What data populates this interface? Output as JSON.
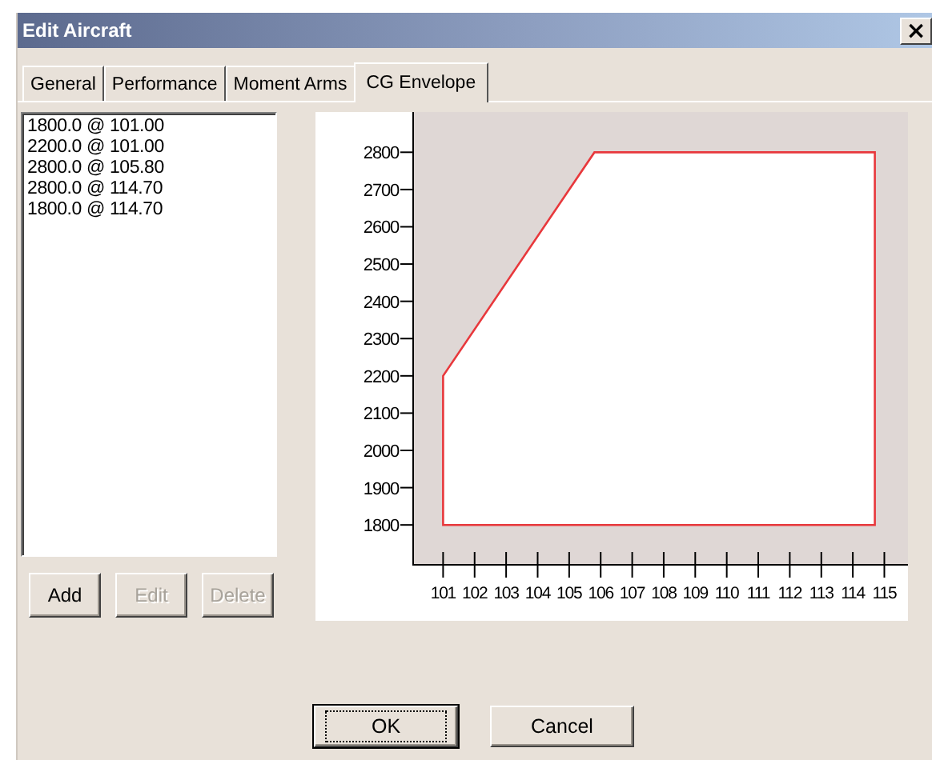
{
  "window": {
    "title": "Edit Aircraft",
    "close": "×"
  },
  "tabs": [
    {
      "label": "General",
      "selected": false
    },
    {
      "label": "Performance",
      "selected": false
    },
    {
      "label": "Moment Arms",
      "selected": false
    },
    {
      "label": "CG Envelope",
      "selected": true
    }
  ],
  "points": [
    "1800.0 @ 101.00",
    "2200.0 @ 101.00",
    "2800.0 @ 105.80",
    "2800.0 @ 114.70",
    "1800.0 @ 114.70"
  ],
  "list_buttons": [
    {
      "label": "Add",
      "disabled": false
    },
    {
      "label": "Edit",
      "disabled": true
    },
    {
      "label": "Delete",
      "disabled": true
    }
  ],
  "chart_data": {
    "type": "area",
    "x": [
      101,
      101,
      105.8,
      114.7,
      114.7,
      101
    ],
    "series": [
      {
        "color": "#e8383c",
        "values": [
          1800,
          2200,
          2800,
          2800,
          1800,
          1800
        ]
      }
    ],
    "xlim": [
      100.05,
      115.75
    ],
    "ylim": [
      1693,
      2908
    ],
    "xticks": [
      {
        "value": 101,
        "label": "101"
      },
      {
        "value": 102,
        "label": "102"
      },
      {
        "value": 103,
        "label": "103"
      },
      {
        "value": 104,
        "label": "104"
      },
      {
        "value": 105,
        "label": "105"
      },
      {
        "value": 106,
        "label": "106"
      },
      {
        "value": 107,
        "label": "107"
      },
      {
        "value": 108,
        "label": "108"
      },
      {
        "value": 109,
        "label": "109"
      },
      {
        "value": 110,
        "label": "110"
      },
      {
        "value": 111,
        "label": "111"
      },
      {
        "value": 112,
        "label": "112"
      },
      {
        "value": 113,
        "label": "113"
      },
      {
        "value": 114,
        "label": "114"
      },
      {
        "value": 115,
        "label": "115"
      }
    ],
    "yticks": [
      1800,
      1900,
      2000,
      2100,
      2200,
      2300,
      2400,
      2500,
      2600,
      2700,
      2800
    ]
  },
  "dialog_buttons": [
    {
      "label": "OK",
      "default": true
    },
    {
      "label": "Cancel",
      "default": false
    }
  ]
}
